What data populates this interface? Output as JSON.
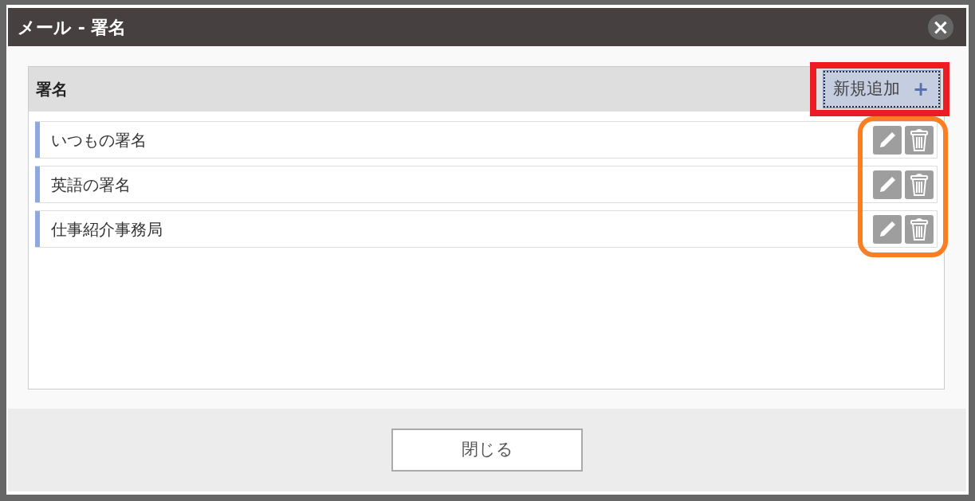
{
  "dialog": {
    "title": "メール - 署名",
    "close_button": "×"
  },
  "panel": {
    "heading": "署名",
    "add_button": {
      "label": "新規追加",
      "icon": "+",
      "highlighted": true
    }
  },
  "signatures": [
    {
      "name": "いつもの署名"
    },
    {
      "name": "英語の署名"
    },
    {
      "name": "仕事紹介事務局"
    }
  ],
  "signature_actions_highlighted": true,
  "footer": {
    "close_label": "閉じる"
  }
}
